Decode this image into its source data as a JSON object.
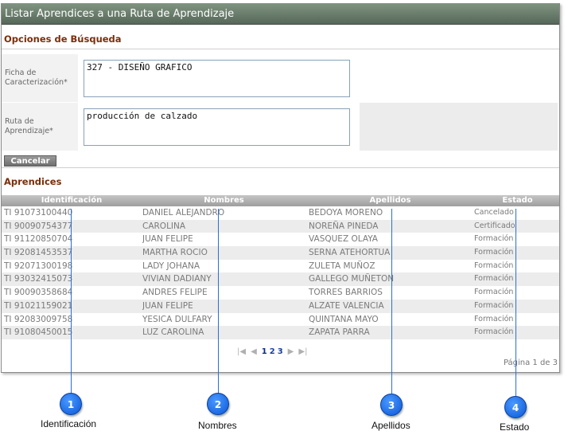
{
  "window": {
    "title": "Listar Aprendices a una Ruta de Aprendizaje"
  },
  "search": {
    "section_title": "Opciones de Búsqueda",
    "ficha_label": "Ficha de Caracterización*",
    "ficha_value": "327 - DISEÑO GRAFICO",
    "ruta_label": "Ruta de Aprendizaje*",
    "ruta_value": "producción de calzado",
    "cancel_label": "Cancelar"
  },
  "aprendices": {
    "section_title": "Aprendices",
    "columns": [
      "Identificación",
      "Nombres",
      "Apellidos",
      "Estado"
    ],
    "rows": [
      [
        "TI 91073100440",
        "DANIEL ALEJANDRO",
        "BEDOYA MORENO",
        "Cancelado"
      ],
      [
        "TI 90090754377",
        "CAROLINA",
        "NOREÑA PINEDA",
        "Certificado"
      ],
      [
        "TI 91120850704",
        "JUAN FELIPE",
        "VASQUEZ OLAYA",
        "Formación"
      ],
      [
        "TI 92081453537",
        "MARTHA ROCIO",
        "SERNA ATEHORTUA",
        "Formación"
      ],
      [
        "TI 92071300198",
        "LADY JOHANA",
        "ZULETA MUÑOZ",
        "Formación"
      ],
      [
        "TI 93032415073",
        "VIVIAN DADIANY",
        "GALLEGO MUÑETON",
        "Formación"
      ],
      [
        "TI 90090358684",
        "ANDRES FELIPE",
        "TORRES BARRIOS",
        "Formación"
      ],
      [
        "TI 91021159021",
        "JUAN FELIPE",
        "ALZATE VALENCIA",
        "Formación"
      ],
      [
        "TI 92083009758",
        "YESICA DULFARY",
        "QUINTANA MAYO",
        "Formación"
      ],
      [
        "TI 91080450015",
        "LUZ CAROLINA",
        "ZAPATA PARRA",
        "Formación"
      ]
    ]
  },
  "pager": {
    "first_icon": "first-page-icon",
    "prev_icon": "prev-page-icon",
    "pages": [
      "1",
      "2",
      "3"
    ],
    "next_icon": "next-page-icon",
    "last_icon": "last-page-icon",
    "page_info": "Página 1 de 3"
  },
  "callouts": [
    {
      "number": "1",
      "label": "Identificación"
    },
    {
      "number": "2",
      "label": "Nombres"
    },
    {
      "number": "3",
      "label": "Apellidos"
    },
    {
      "number": "4",
      "label": "Estado"
    }
  ],
  "colors": {
    "title_bar": "#56685a",
    "section_title": "#7a2e0a",
    "callout": "#0a56d8",
    "link": "#1a3f9a"
  }
}
